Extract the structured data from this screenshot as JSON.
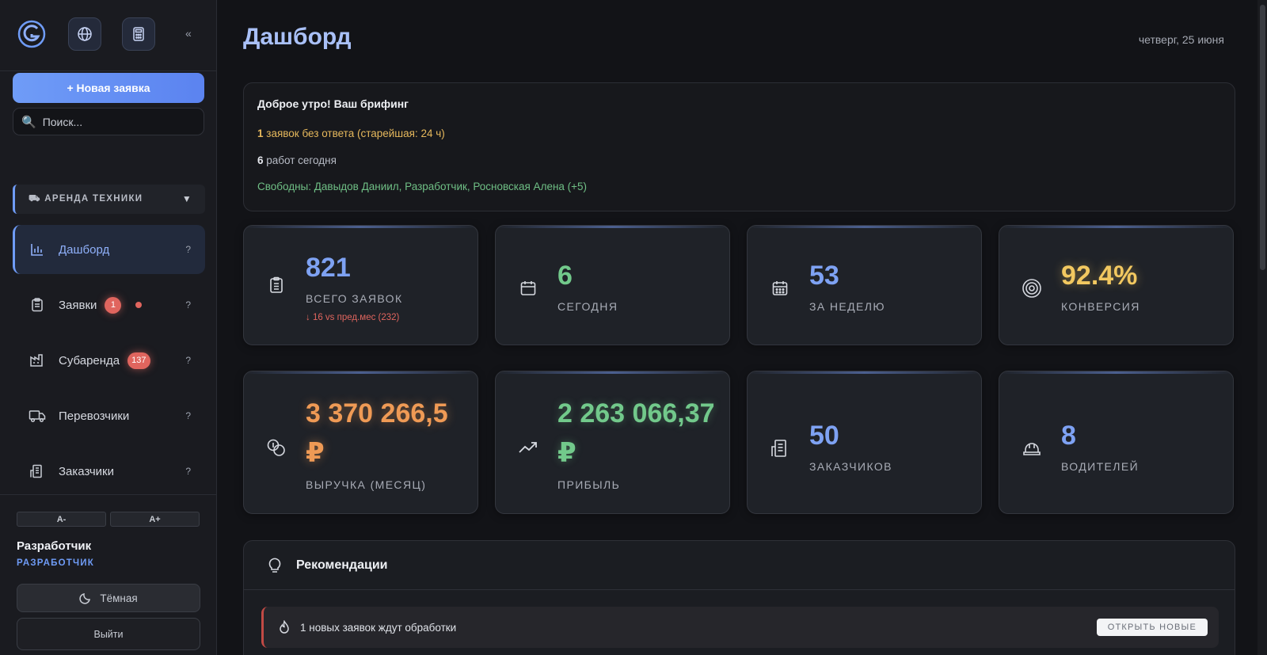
{
  "sidebar": {
    "new_request_label": "+ Новая заявка",
    "search_placeholder": "Поиск...",
    "section_label": "⛟ АРЕНДА ТЕХНИКИ",
    "items": [
      {
        "label": "Дашборд",
        "help": "?",
        "icon": "bar-chart-icon",
        "active": true
      },
      {
        "label": "Заявки",
        "help": "?",
        "badge": "1",
        "icon": "clipboard-icon"
      },
      {
        "label": "Субаренда",
        "help": "?",
        "badge": "137",
        "icon": "factory-icon"
      },
      {
        "label": "Перевозчики",
        "help": "?",
        "icon": "truck-icon"
      },
      {
        "label": "Заказчики",
        "help": "?",
        "icon": "building-icon"
      }
    ],
    "font_decrease": "A-",
    "font_increase": "A+",
    "user_name": "Разработчик",
    "user_role": "РАЗРАБОТЧИК",
    "theme_label": "Тёмная",
    "logout_label": "Выйти",
    "collapse": "«",
    "accent": "#6f9cf7"
  },
  "header": {
    "title": "Дашборд",
    "date": "четверг, 25 июня"
  },
  "briefing": {
    "title": "Доброе утро! Ваш брифинг",
    "unanswered_count": "1",
    "unanswered_text": " заявок без ответа (старейшая: 24 ч)",
    "jobs_count": "6",
    "jobs_text": " работ сегодня",
    "free_text": "Свободны: Давыдов Даниил, Разработчик, Росновская Алена (+5)"
  },
  "stats": [
    {
      "value": "821",
      "label": "ВСЕГО ЗАЯВОК",
      "sub": "↓ 16 vs пред.мес (232)",
      "icon": "clipboard-list-icon",
      "color": "#7ea2f3"
    },
    {
      "value": "6",
      "label": "СЕГОДНЯ",
      "icon": "calendar-icon",
      "color": "#72c98b"
    },
    {
      "value": "53",
      "label": "ЗА НЕДЕЛЮ",
      "icon": "calendar-grid-icon",
      "color": "#7ea2f3"
    },
    {
      "value": "92.4%",
      "label": "КОНВЕРСИЯ",
      "icon": "target-icon",
      "color": "#f2c860"
    },
    {
      "value": "3 370 266,5",
      "value2": "₽",
      "label": "ВЫРУЧКА (МЕСЯЦ)",
      "icon": "coins-icon",
      "color": "#ef9a55"
    },
    {
      "value": "2 263 066,37",
      "value2": "₽",
      "label": "ПРИБЫЛЬ",
      "icon": "trending-up-icon",
      "color": "#72c98b"
    },
    {
      "value": "50",
      "label": "ЗАКАЗЧИКОВ",
      "icon": "building-icon",
      "color": "#7ea2f3"
    },
    {
      "value": "8",
      "label": "ВОДИТЕЛЕЙ",
      "icon": "hard-hat-icon",
      "color": "#7ea2f3"
    }
  ],
  "recommendations": {
    "title": "Рекомендации",
    "items": [
      {
        "text": "1 новых заявок ждут обработки",
        "action": "ОТКРЫТЬ НОВЫЕ",
        "icon": "flame-icon"
      }
    ]
  }
}
